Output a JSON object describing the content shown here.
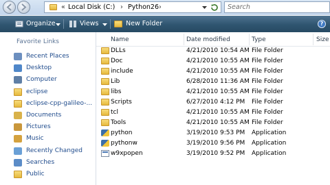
{
  "address_bar": {
    "path_prefix": "«",
    "crumbs": [
      "Local Disk (C:)",
      "Python26"
    ],
    "separator": "›",
    "search_placeholder": "Search"
  },
  "toolbar": {
    "organize_label": "Organize",
    "views_label": "Views",
    "new_folder_label": "New Folder"
  },
  "nav": {
    "heading": "Favorite Links",
    "items": [
      {
        "label": "Recent Places",
        "icon": "recent-places-icon"
      },
      {
        "label": "Desktop",
        "icon": "desktop-icon"
      },
      {
        "label": "Computer",
        "icon": "computer-icon"
      },
      {
        "label": "eclipse",
        "icon": "folder-icon"
      },
      {
        "label": "eclipse-cpp-galileo-...",
        "icon": "folder-icon"
      },
      {
        "label": "Documents",
        "icon": "documents-icon"
      },
      {
        "label": "Pictures",
        "icon": "pictures-icon"
      },
      {
        "label": "Music",
        "icon": "music-icon"
      },
      {
        "label": "Recently Changed",
        "icon": "recently-changed-icon"
      },
      {
        "label": "Searches",
        "icon": "searches-icon"
      },
      {
        "label": "Public",
        "icon": "folder-icon"
      }
    ]
  },
  "columns": {
    "name": "Name",
    "date": "Date modified",
    "type": "Type",
    "size": "Size"
  },
  "files": [
    {
      "name": "DLLs",
      "date": "4/21/2010 10:54 AM",
      "type": "File Folder",
      "kind": "folder"
    },
    {
      "name": "Doc",
      "date": "4/21/2010 10:55 AM",
      "type": "File Folder",
      "kind": "folder"
    },
    {
      "name": "include",
      "date": "4/21/2010 10:55 AM",
      "type": "File Folder",
      "kind": "folder"
    },
    {
      "name": "Lib",
      "date": "6/28/2010 11:36 AM",
      "type": "File Folder",
      "kind": "folder"
    },
    {
      "name": "libs",
      "date": "4/21/2010 10:55 AM",
      "type": "File Folder",
      "kind": "folder"
    },
    {
      "name": "Scripts",
      "date": "6/27/2010 4:12 PM",
      "type": "File Folder",
      "kind": "folder"
    },
    {
      "name": "tcl",
      "date": "4/21/2010 10:55 AM",
      "type": "File Folder",
      "kind": "folder"
    },
    {
      "name": "Tools",
      "date": "4/21/2010 10:55 AM",
      "type": "File Folder",
      "kind": "folder"
    },
    {
      "name": "python",
      "date": "3/19/2010 9:53 PM",
      "type": "Application",
      "kind": "python"
    },
    {
      "name": "pythonw",
      "date": "3/19/2010 9:56 PM",
      "type": "Application",
      "kind": "python"
    },
    {
      "name": "w9xpopen",
      "date": "3/19/2010 9:52 PM",
      "type": "Application",
      "kind": "app"
    }
  ]
}
